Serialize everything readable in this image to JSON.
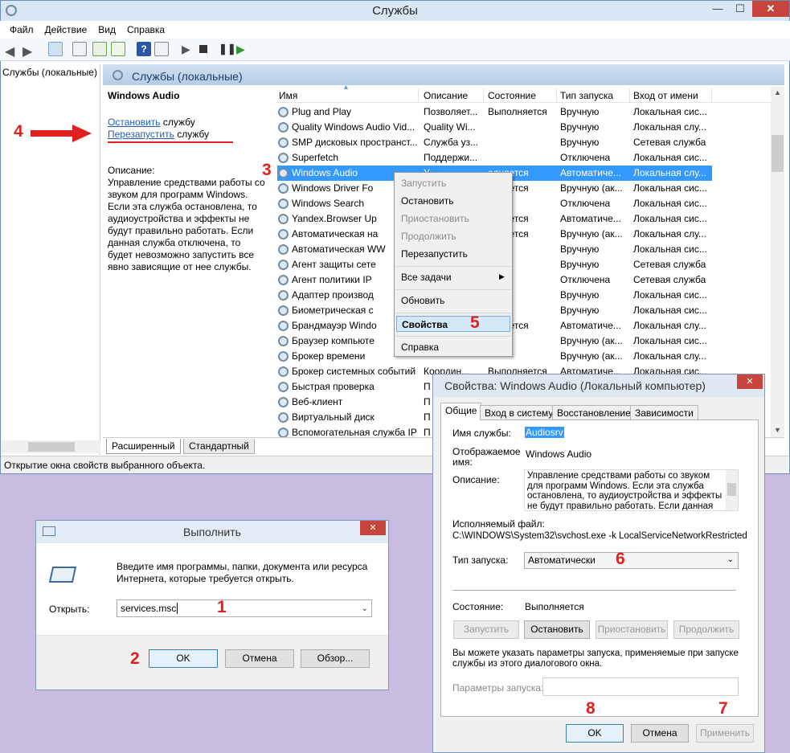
{
  "services_window": {
    "title": "Службы",
    "menu": [
      "Файл",
      "Действие",
      "Вид",
      "Справка"
    ],
    "tree_item": "Службы (локальные)",
    "pane_title": "Службы (локальные)",
    "left": {
      "service_name": "Windows Audio",
      "stop_link": "Остановить",
      "stop_suffix": " службу",
      "restart_link": "Перезапустить",
      "restart_suffix": " службу",
      "desc_label": "Описание:",
      "desc_text": "Управление средствами работы со звуком для программ Windows. Если эта служба остановлена, то аудиоустройства и эффекты не будут правильно работать.  Если данная служба отключена, то будет невозможно запустить все явно зависящие от нее службы."
    },
    "columns": [
      "Имя",
      "Описание",
      "Состояние",
      "Тип запуска",
      "Вход от имени"
    ],
    "rows": [
      [
        "Plug and Play",
        "Позволяет...",
        "Выполняется",
        "Вручную",
        "Локальная сис..."
      ],
      [
        "Quality Windows Audio Vid...",
        "Quality Wi...",
        "",
        "Вручную",
        "Локальная слу..."
      ],
      [
        "SMP дисковых пространст...",
        "Служба уз...",
        "",
        "Вручную",
        "Сетевая служба"
      ],
      [
        "Superfetch",
        "Поддержи...",
        "",
        "Отключена",
        "Локальная сис..."
      ],
      [
        "Windows Audio",
        "У",
        "олняется",
        "Автоматиче...",
        "Локальная слу..."
      ],
      [
        "Windows Driver Fo",
        "",
        "олняется",
        "Вручную (ак...",
        "Локальная сис..."
      ],
      [
        "Windows Search",
        "",
        "",
        "Отключена",
        "Локальная сис..."
      ],
      [
        "Yandex.Browser Up",
        "",
        "олняется",
        "Автоматиче...",
        "Локальная сис..."
      ],
      [
        "Автоматическая на",
        "",
        "олняется",
        "Вручную (ак...",
        "Локальная слу..."
      ],
      [
        "Автоматическая WW",
        "",
        "",
        "Вручную",
        "Локальная сис..."
      ],
      [
        "Агент защиты сете",
        "",
        "",
        "Вручную",
        "Сетевая служба"
      ],
      [
        "Агент политики IP",
        "",
        "",
        "Отключена",
        "Сетевая служба"
      ],
      [
        "Адаптер производ",
        "",
        "",
        "Вручную",
        "Локальная сис..."
      ],
      [
        "Биометрическая с",
        "",
        "",
        "Вручную",
        "Локальная сис..."
      ],
      [
        "Брандмауэр Windo",
        "",
        "олняется",
        "Автоматиче...",
        "Локальная слу..."
      ],
      [
        "Браузер компьюте",
        "",
        "",
        "Вручную (ак...",
        "Локальная сис..."
      ],
      [
        "Брокер времени",
        "",
        "",
        "Вручную (ак...",
        "Локальная слу..."
      ],
      [
        "Брокер системных событий",
        "Координ...",
        "Выполняется",
        "Автоматиче...",
        "Локальная сис..."
      ],
      [
        "Быстрая проверка",
        "П",
        "",
        "",
        "",
        ""
      ],
      [
        "Веб-клиент",
        "П",
        "",
        "",
        "",
        ""
      ],
      [
        "Виртуальный диск",
        "П",
        "",
        "",
        "",
        ""
      ],
      [
        "Вспомогательная служба IP",
        "П",
        "",
        "",
        "",
        ""
      ]
    ],
    "tabs": [
      "Расширенный",
      "Стандартный"
    ],
    "status": "Открытие окна свойств выбранного объекта."
  },
  "context_menu": {
    "items": [
      "Запустить",
      "Остановить",
      "Приостановить",
      "Продолжить",
      "Перезапустить",
      "Все задачи",
      "Обновить",
      "Свойства",
      "Справка"
    ]
  },
  "run_dialog": {
    "title": "Выполнить",
    "prompt": "Введите имя программы, папки, документа или ресурса Интернета, которые требуется открыть.",
    "open_label": "Открыть:",
    "value": "services.msc",
    "ok": "OK",
    "cancel": "Отмена",
    "browse": "Обзор..."
  },
  "props": {
    "title": "Свойства: Windows Audio (Локальный компьютер)",
    "tabs": [
      "Общие",
      "Вход в систему",
      "Восстановление",
      "Зависимости"
    ],
    "service_name_label": "Имя службы:",
    "service_name": "Audiosrv",
    "display_label": "Отображаемое имя:",
    "display_name": "Windows Audio",
    "desc_label": "Описание:",
    "desc": "Управление средствами работы со звуком для программ Windows.  Если эта служба остановлена, то аудиоустройства и эффекты не будут правильно работать.  Если данная служба",
    "exe_label": "Исполняемый файл:",
    "exe": "C:\\WINDOWS\\System32\\svchost.exe -k LocalServiceNetworkRestricted",
    "startup_label": "Тип запуска:",
    "startup": "Автоматически",
    "state_label": "Состояние:",
    "state": "Выполняется",
    "start": "Запустить",
    "stop": "Остановить",
    "pause": "Приостановить",
    "resume": "Продолжить",
    "hint": "Вы можете указать параметры запуска, применяемые при запуске службы из этого диалогового окна.",
    "params_label": "Параметры запуска:",
    "ok": "OK",
    "cancel": "Отмена",
    "apply": "Применить"
  },
  "markers": [
    "1",
    "2",
    "3",
    "4",
    "5",
    "6",
    "7",
    "8"
  ],
  "colors": {
    "accent": "#3399ff",
    "marker": "#e0201e",
    "close": "#c7453c"
  }
}
